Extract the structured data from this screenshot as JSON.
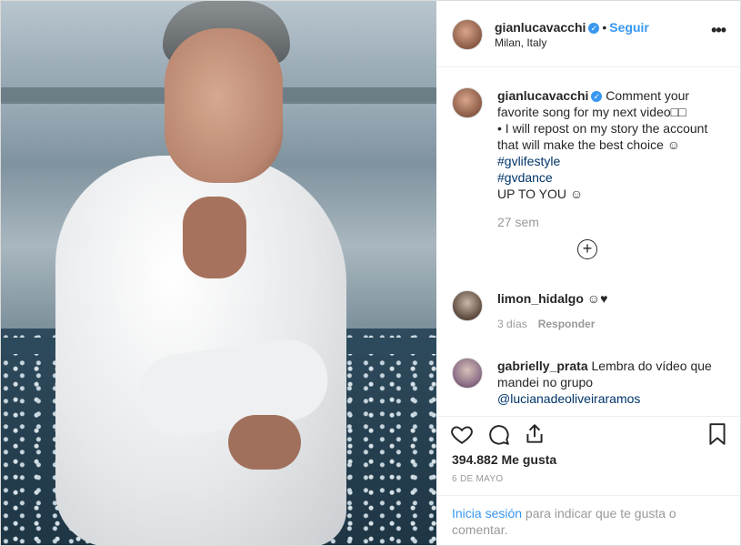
{
  "header": {
    "username": "gianlucavacchi",
    "follow_label": "Seguir",
    "location": "Milan, Italy"
  },
  "caption": {
    "username": "gianlucavacchi",
    "line1": "Comment your favorite song for my next video□□",
    "line2": "• I will repost on my story the account that will make the best choice ☺",
    "hashtag1": "#gvlifestyle",
    "hashtag2": "#gvdance",
    "line3": "UP TO YOU ☺",
    "time": "27 sem"
  },
  "comments": [
    {
      "username": "limon_hidalgo",
      "text": "☺♥",
      "time": "3 días",
      "reply_label": "Responder"
    },
    {
      "username": "gabrielly_prata",
      "text": "Lembra do vídeo que mandei no grupo",
      "mention": "@lucianadeoliveiraramos"
    }
  ],
  "likes_text": "394.882 Me gusta",
  "date": "6 DE MAYO",
  "login": {
    "link": "Inicia sesión",
    "text": " para indicar que te gusta o comentar."
  },
  "colors": {
    "accent": "#3897f0",
    "hashtag": "#003569",
    "muted": "#999999",
    "border": "#dbdbdb"
  },
  "icons": [
    "verified-badge-icon",
    "more-options-icon",
    "load-more-comments-icon",
    "heart-icon",
    "comment-icon",
    "share-icon",
    "bookmark-icon"
  ]
}
